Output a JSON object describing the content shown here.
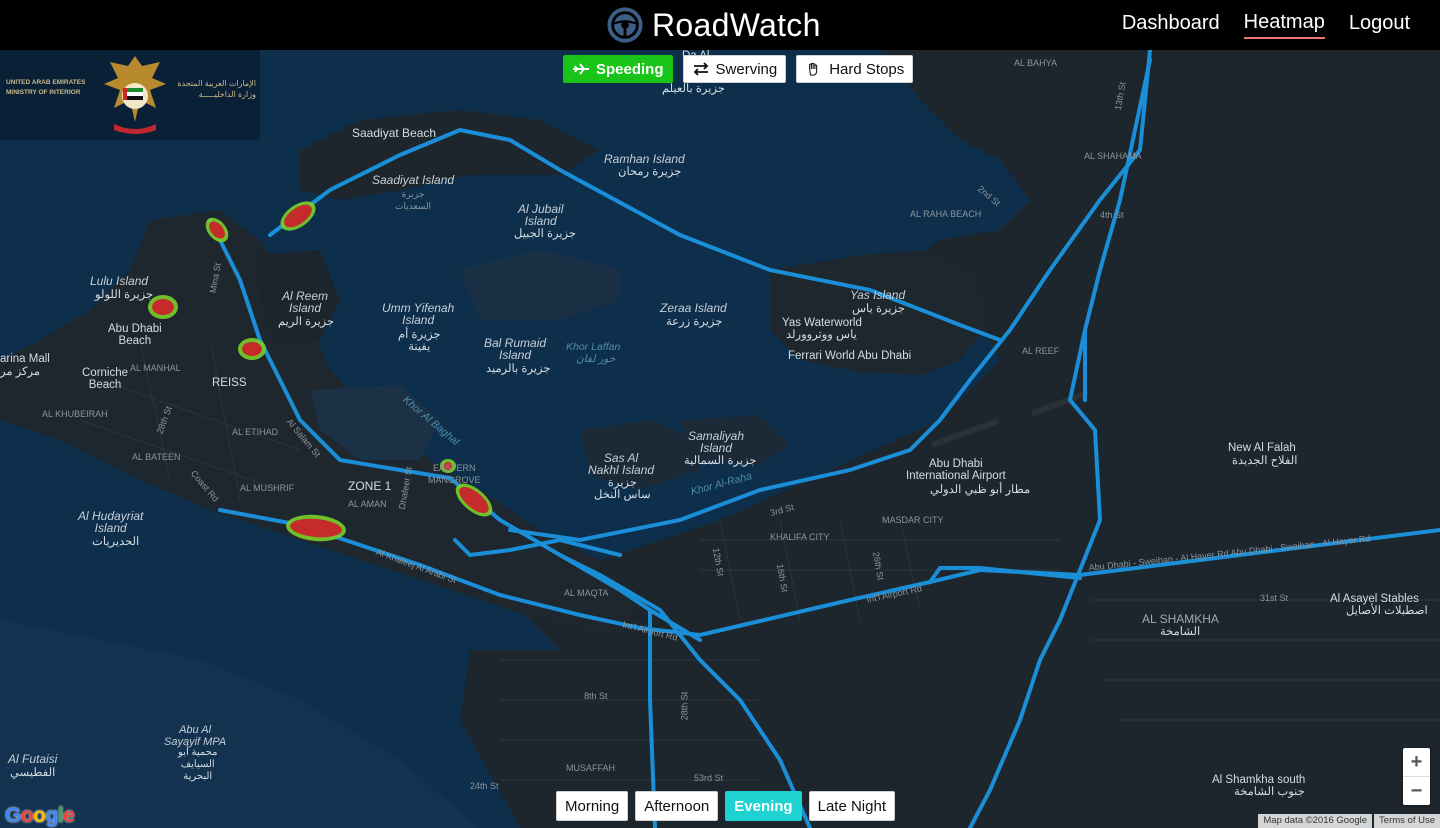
{
  "app": {
    "title": "RoadWatch",
    "nav": [
      {
        "label": "Dashboard",
        "active": false
      },
      {
        "label": "Heatmap",
        "active": true
      },
      {
        "label": "Logout",
        "active": false
      }
    ]
  },
  "ministry": {
    "en_line1": "UNITED ARAB EMIRATES",
    "en_line2": "MINISTRY OF INTERIOR",
    "ar_line1": "الإمارات العربية المتحدة",
    "ar_line2": "وزارة الداخليـــــة"
  },
  "filters": {
    "speeding": {
      "label": "Speeding",
      "active": true,
      "icon": "plane-icon"
    },
    "swerving": {
      "label": "Swerving",
      "active": false,
      "icon": "swap-arrows-icon"
    },
    "hard_stops": {
      "label": "Hard Stops",
      "active": false,
      "icon": "hand-icon"
    }
  },
  "times": [
    {
      "label": "Morning",
      "active": false
    },
    {
      "label": "Afternoon",
      "active": false
    },
    {
      "label": "Evening",
      "active": true
    },
    {
      "label": "Late Night",
      "active": false
    }
  ],
  "colors": {
    "active_filter": "#18c418",
    "active_time": "#1fd2d2",
    "road": "#1a8fd8",
    "heat_core": "#c62b2b",
    "heat_halo": "#79d02a",
    "water": "#0e2f4c",
    "land": "#1e262d"
  },
  "map_labels": {
    "saadiyat_beach": "Saadiyat Beach",
    "saadiyat_island": "Saadiyat Island",
    "saadiyat_island_ar": "جزيرة\nالسعديات",
    "ramhan_island": "Ramhan Island",
    "ramhan_island_ar": "جزيرة رمحان",
    "al_jubail": "Al Jubail\nIsland",
    "al_jubail_ar": "جزيرة الجبيل",
    "al_reem": "Al Reem\nIsland",
    "al_reem_ar": "جزيرة الريم",
    "umm_yifenah": "Umm Yifenah\nIsland",
    "umm_yifenah_ar": "جزيرة أم\nيفينة",
    "bal_rumaid": "Bal Rumaid\nIsland",
    "bal_rumaid_ar": "جزيرة بالرميد",
    "khor_laffan": "Khor Laffan",
    "khor_laffan_ar": "خور لفان",
    "zeraa": "Zeraa Island",
    "zeraa_ar": "جزيرة زرعة",
    "yas": "Yas Island",
    "yas_ar": "جزيرة ياس",
    "yas_waterworld": "Yas Waterworld",
    "yas_waterworld_ar": "ياس ووتروورلد",
    "ferrari": "Ferrari World Abu Dhabi",
    "lulu": "Lulu Island",
    "lulu_ar": "جزيرة اللولو",
    "abu_dhabi_beach": "Abu Dhabi\nBeach",
    "marina_mall": "arina Mall",
    "marina_mall_ar": "مركز مر",
    "corniche": "Corniche\nBeach",
    "reiss": "REISS",
    "al_khubeirah": "AL KHUBEIRAH",
    "al_manhal": "AL MANHAL",
    "al_etihad": "AL ETIHAD",
    "al_bateen": "AL BATEEN",
    "al_mushrif": "AL MUSHRIF",
    "zone1": "ZONE 1",
    "al_aman": "AL AMAN",
    "eastern_mangrove": "EASTERN\nMANGROVE",
    "al_hudayriat": "Al Hudayriat\nIsland",
    "al_hudayriat_ar": "الحديريات",
    "sas_al_nakhl": "Sas Al\nNakhl Island",
    "sas_al_nakhl_ar": "جزيرة\nساس النخل",
    "samaliyah": "Samaliyah\nIsland",
    "samaliyah_ar": "جزيرة السمالية",
    "khor_al_raha": "Khor Al-Raha",
    "khor_al_baghal": "Khor Al Baghal",
    "airport": "Abu Dhabi\nInternational Airport",
    "airport_ar": "مطار أبو ظبي الدولي",
    "masdar": "MASDAR CITY",
    "khalifa": "KHALIFA CITY",
    "new_al_falah": "New Al Falah",
    "new_al_falah_ar": "الفلاح الجديدة",
    "al_shamkha": "AL SHAMKHA",
    "al_shamkha_ar": "الشامخة",
    "al_asayel": "Al Asayel Stables",
    "al_asayel_ar": "اصطبلات الأصايل",
    "al_shamkha_south": "Al Shamkha south",
    "al_shamkha_south_ar": "جنوب الشامخة",
    "al_futaisi": "Al Futaisi",
    "al_futaisi_ar": "الفطيسي",
    "sayayif": "Abu Al\nSayayif MPA",
    "sayayif_ar": "محمية أبو\nالسيايف\nالبحرية",
    "al_raha_beach": "AL RAHA BEACH",
    "al_shahama": "AL SHAHAMA",
    "al_bahya": "AL BAHYA",
    "al_reef": "AL REEF",
    "al_maqta": "AL MAQTA",
    "musaffah": "MUSAFFAH",
    "al_salam_st": "Al Salam St",
    "al_khaleej_st": "Al Khaleej Al Arabi St",
    "intl_airport_rd": "Int'l Airport Rd",
    "intl_airport_rd2": "Int'l Airport Rd",
    "sweihan_rd": "Abu Dhabi - Sweihan - Al Hayer Rd   Abu Dhabi - Sweihan - Al Hayer Rd",
    "coast_rd": "Coast Rd",
    "mina_st": "Mina St",
    "dhafeer_st": "Dhafeer St",
    "st_28": "28th St",
    "st_3rd": "3rd St",
    "st_12th": "12th St",
    "st_16th": "16th St",
    "st_26th": "26th St",
    "st_8th": "8th St",
    "st_28th": "28th St",
    "st_24th": "24th St",
    "st_53rd": "53rd St",
    "st_31st": "31st St",
    "st_13th": "13th St",
    "st_4th": "4th St",
    "st_2nd": "2nd St",
    "jubail_ar_top": "جزيرة بالعيلم",
    "da_al": "Da Al"
  },
  "zoom": {
    "in_label": "+",
    "out_label": "−"
  },
  "attribution": {
    "map_data": "Map data ©2016 Google",
    "terms": "Terms of Use"
  },
  "google_logo": "Google"
}
